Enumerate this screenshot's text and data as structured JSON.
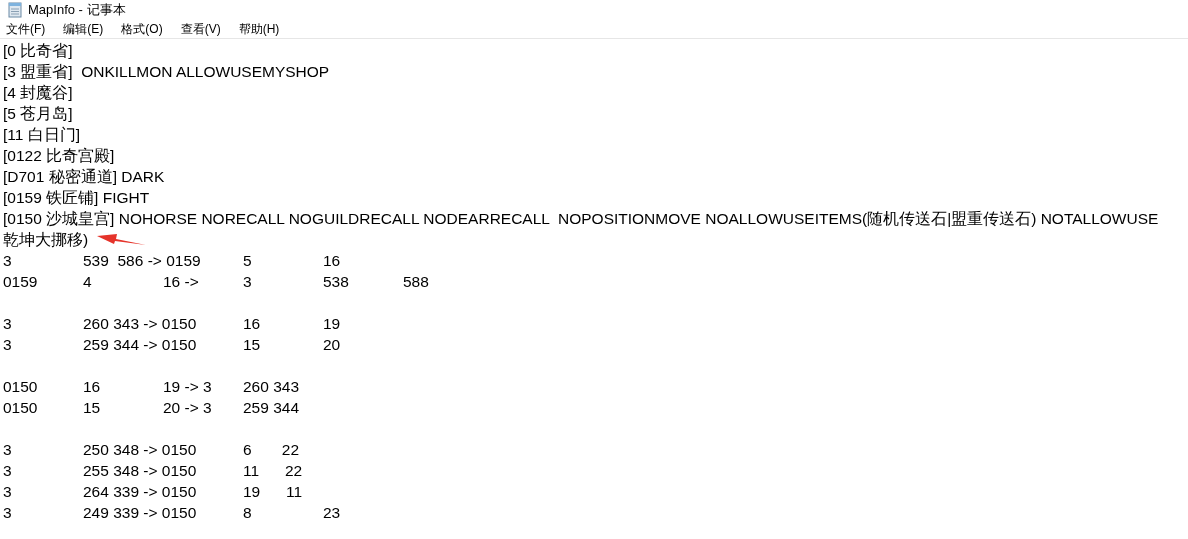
{
  "window": {
    "title": "MapInfo - 记事本"
  },
  "menu": [
    "文件(F)",
    "编辑(E)",
    "格式(O)",
    "查看(V)",
    "帮助(H)"
  ],
  "text_blocks": [
    [
      "[0 比奇省]",
      "[3 盟重省]  ONKILLMON ALLOWUSEMYSHOP",
      "[4 封魔谷]",
      "[5 苍月岛]",
      "[11 白日门]",
      "[0122 比奇宫殿]",
      "[D701 秘密通道] DARK",
      "[0159 铁匠铺] FIGHT",
      "[0150 沙城皇宫] NOHORSE NORECALL NOGUILDRECALL NODEARRECALL  NOPOSITIONMOVE NOALLOWUSEITEMS(随机传送石|盟重传送石) NOTALLOWUSE",
      "乾坤大挪移)",
      "3\t539  586 -> 0159\t5\t16",
      "0159\t4\t16 ->\t3\t538\t588"
    ],
    [
      "3\t260 343 -> 0150\t16\t19",
      "3\t259 344 -> 0150\t15\t20"
    ],
    [
      "0150\t16\t19 -> 3\t260 343",
      "0150\t15\t20 -> 3\t259 344"
    ],
    [
      "3\t250 348 -> 0150\t6       22",
      "3\t255 348 -> 0150\t11      22",
      "3\t264 339 -> 0150\t19      11",
      "3\t249 339 -> 0150\t8\t23"
    ]
  ]
}
